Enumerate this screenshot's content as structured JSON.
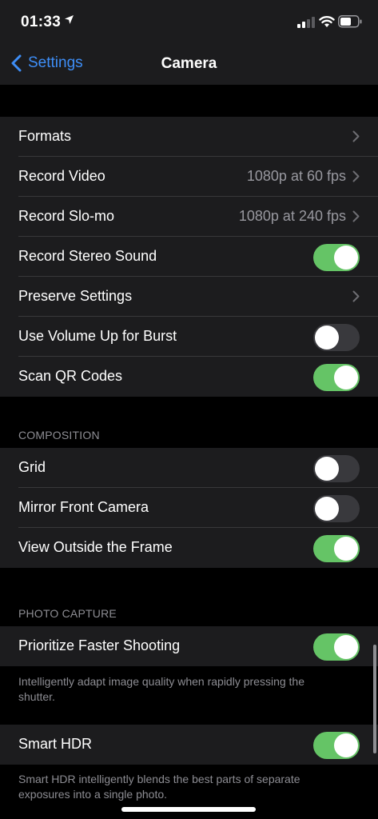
{
  "status": {
    "time": "01:33"
  },
  "nav": {
    "back_label": "Settings",
    "title": "Camera"
  },
  "general": [
    {
      "label": "Formats",
      "type": "chevron"
    },
    {
      "label": "Record Video",
      "type": "value",
      "value": "1080p at 60 fps"
    },
    {
      "label": "Record Slo-mo",
      "type": "value",
      "value": "1080p at 240 fps"
    },
    {
      "label": "Record Stereo Sound",
      "type": "toggle",
      "on": true
    },
    {
      "label": "Preserve Settings",
      "type": "chevron"
    },
    {
      "label": "Use Volume Up for Burst",
      "type": "toggle",
      "on": false
    },
    {
      "label": "Scan QR Codes",
      "type": "toggle",
      "on": true
    }
  ],
  "composition": {
    "header": "COMPOSITION",
    "items": [
      {
        "label": "Grid",
        "type": "toggle",
        "on": false
      },
      {
        "label": "Mirror Front Camera",
        "type": "toggle",
        "on": false
      },
      {
        "label": "View Outside the Frame",
        "type": "toggle",
        "on": true
      }
    ]
  },
  "photo_capture": {
    "header": "PHOTO CAPTURE",
    "items": [
      {
        "label": "Prioritize Faster Shooting",
        "type": "toggle",
        "on": true
      }
    ],
    "footer": "Intelligently adapt image quality when rapidly pressing the shutter."
  },
  "smart_hdr": {
    "items": [
      {
        "label": "Smart HDR",
        "type": "toggle",
        "on": true
      }
    ],
    "footer": "Smart HDR intelligently blends the best parts of separate exposures into a single photo."
  },
  "colors": {
    "accent": "#3e8ef7",
    "toggle_on": "#65c466",
    "toggle_off": "#39393d",
    "cell_bg": "#1c1c1e"
  }
}
